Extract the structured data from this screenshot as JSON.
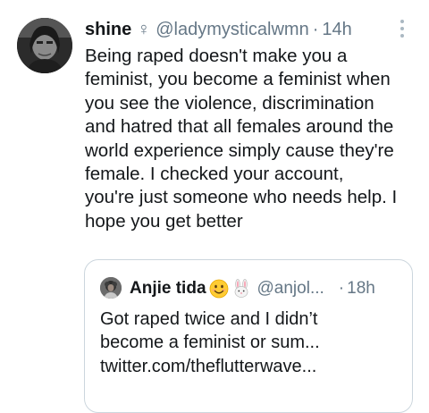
{
  "tweet": {
    "display_name": "shine",
    "gender_symbol": "♀",
    "handle": "@ladymysticalwmn",
    "separator": "·",
    "time": "14h",
    "avatar_icon": "profile-photo-avatar",
    "more_icon": "vertical-ellipsis-icon",
    "body_lines": [
      "Being raped doesn't make you a",
      "feminist, you become a feminist when",
      "you see the violence, discrimination",
      "and hatred that all females around the",
      "world experience simply cause they're",
      "female. I checked your account,",
      "you're just someone who needs help. I",
      "hope you get better"
    ]
  },
  "quoted": {
    "display_name": "Anjie tida",
    "emojis": [
      "smiling-face-emoji",
      "rabbit-face-emoji"
    ],
    "handle": "@anjol...",
    "separator": "·",
    "time": "18h",
    "avatar_icon": "profile-photo-avatar",
    "text_lines": [
      "Got raped twice and I didn’t",
      "become a feminist or sum...",
      "twitter.com/theflutterwave..."
    ]
  },
  "colors": {
    "text_primary": "#14171a",
    "text_secondary": "#657786",
    "border": "#ccd6dd",
    "background": "#ffffff"
  }
}
